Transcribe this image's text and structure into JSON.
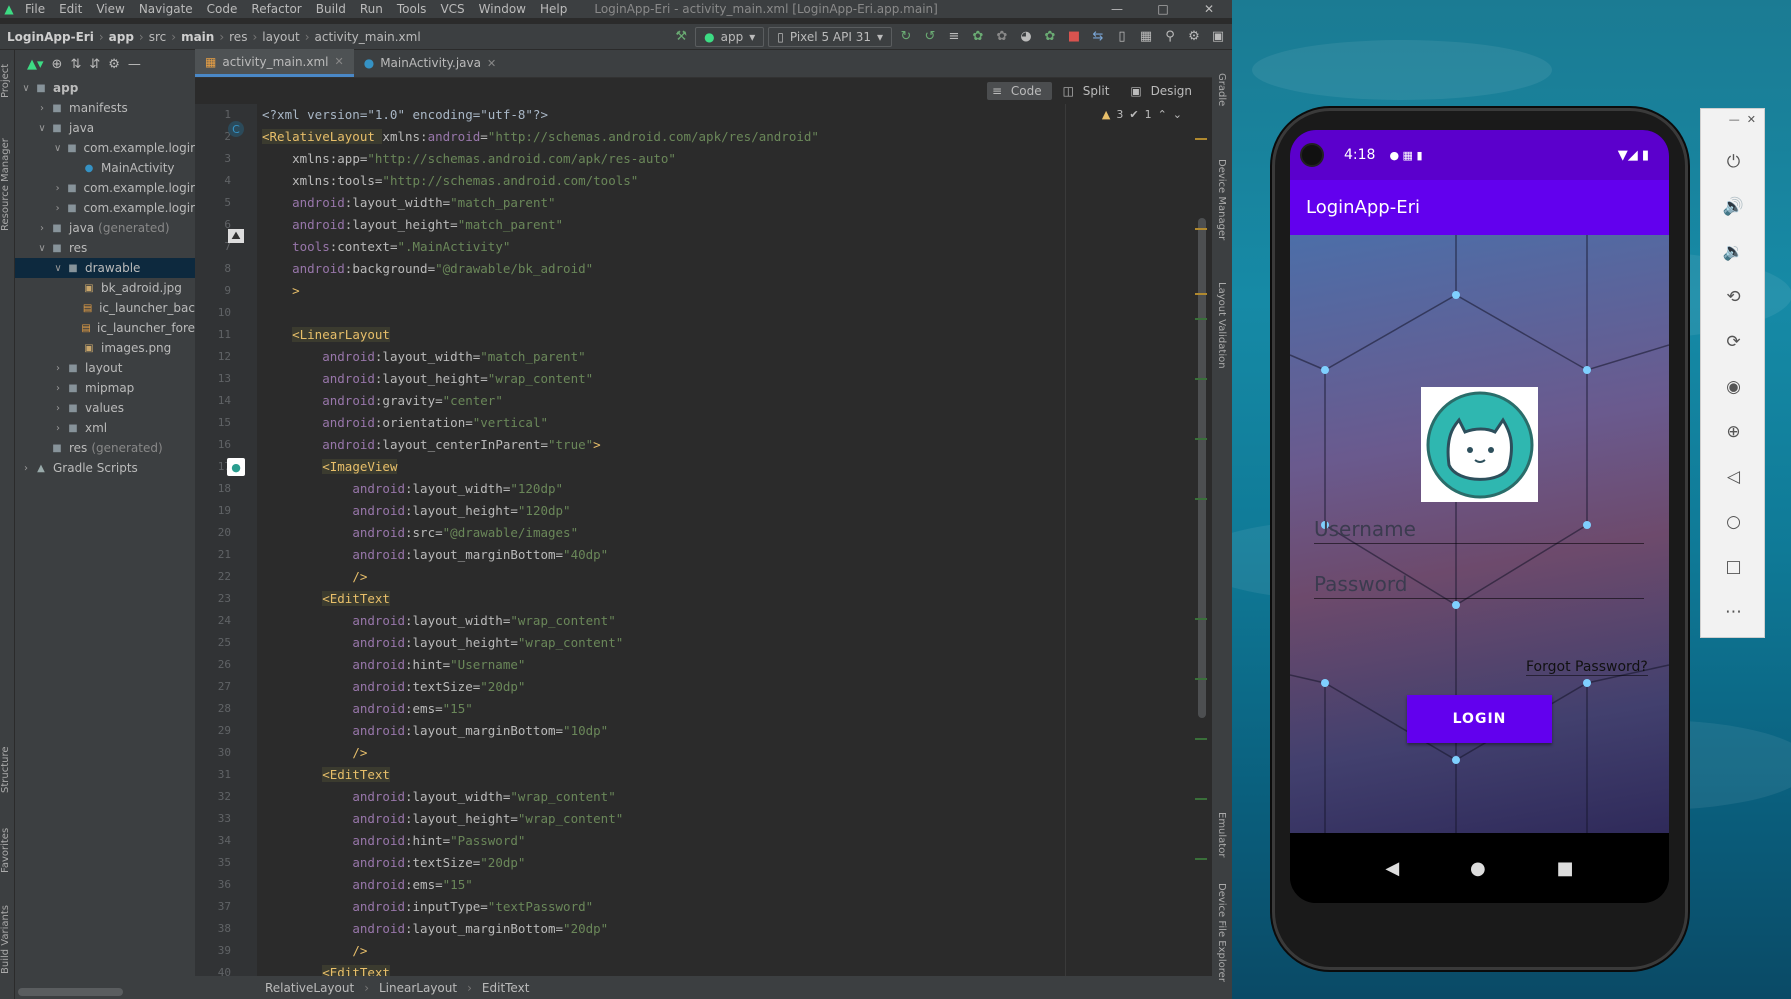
{
  "ide": {
    "menu": [
      "File",
      "Edit",
      "View",
      "Navigate",
      "Code",
      "Refactor",
      "Build",
      "Run",
      "Tools",
      "VCS",
      "Window",
      "Help"
    ],
    "window_title": "LoginApp-Eri - activity_main.xml [LoginApp-Eri.app.main]",
    "breadcrumb": [
      "LoginApp-Eri",
      "app",
      "src",
      "main",
      "res",
      "layout",
      "activity_main.xml"
    ],
    "run_config": "app",
    "device": "Pixel 5 API 31",
    "tabs": [
      "activity_main.xml",
      "MainActivity.java"
    ],
    "view_modes": [
      "Code",
      "Split",
      "Design"
    ],
    "warnings": {
      "warn_count": "3",
      "weak_count": "1"
    },
    "left_tool_windows": [
      "Project",
      "Resource Manager",
      "Structure",
      "Favorites",
      "Build Variants"
    ],
    "right_tool_windows": [
      "Gradle",
      "Device Manager",
      "Layout Validation",
      "Emulator",
      "Device File Explorer"
    ],
    "status_path": [
      "RelativeLayout",
      "LinearLayout",
      "EditText"
    ]
  },
  "project_tree": [
    {
      "label": "app",
      "indent": 0,
      "arrow": "v",
      "type": "folder",
      "bold": true
    },
    {
      "label": "manifests",
      "indent": 1,
      "arrow": ">",
      "type": "folder"
    },
    {
      "label": "java",
      "indent": 1,
      "arrow": "v",
      "type": "folder"
    },
    {
      "label": "com.example.logir",
      "indent": 2,
      "arrow": "v",
      "type": "pkg"
    },
    {
      "label": "MainActivity",
      "indent": 3,
      "arrow": "",
      "type": "class"
    },
    {
      "label": "com.example.logir",
      "indent": 2,
      "arrow": ">",
      "type": "pkg"
    },
    {
      "label": "com.example.logir",
      "indent": 2,
      "arrow": ">",
      "type": "pkg"
    },
    {
      "label": "java",
      "suffix": "(generated)",
      "indent": 1,
      "arrow": ">",
      "type": "folder"
    },
    {
      "label": "res",
      "indent": 1,
      "arrow": "v",
      "type": "folder"
    },
    {
      "label": "drawable",
      "indent": 2,
      "arrow": "v",
      "type": "folder",
      "selected": true
    },
    {
      "label": "bk_adroid.jpg",
      "indent": 3,
      "arrow": "",
      "type": "img"
    },
    {
      "label": "ic_launcher_bac",
      "indent": 3,
      "arrow": "",
      "type": "xml"
    },
    {
      "label": "ic_launcher_fore",
      "indent": 3,
      "arrow": "",
      "type": "xml"
    },
    {
      "label": "images.png",
      "indent": 3,
      "arrow": "",
      "type": "img"
    },
    {
      "label": "layout",
      "indent": 2,
      "arrow": ">",
      "type": "folder"
    },
    {
      "label": "mipmap",
      "indent": 2,
      "arrow": ">",
      "type": "folder"
    },
    {
      "label": "values",
      "indent": 2,
      "arrow": ">",
      "type": "folder"
    },
    {
      "label": "xml",
      "indent": 2,
      "arrow": ">",
      "type": "folder"
    },
    {
      "label": "res",
      "suffix": "(generated)",
      "indent": 1,
      "arrow": "",
      "type": "folder"
    },
    {
      "label": "Gradle Scripts",
      "indent": 0,
      "arrow": ">",
      "type": "gradle"
    }
  ],
  "code_lines": [
    [
      [
        "p",
        "<?xml version=\"1.0\" encoding=\"utf-8\"?>"
      ]
    ],
    [
      [
        "t",
        "<RelativeLayout "
      ],
      [
        "attr",
        "xmlns:"
      ],
      [
        "ns",
        "android"
      ],
      [
        "attr",
        "="
      ],
      [
        "str",
        "\"http://schemas.android.com/apk/res/android\""
      ]
    ],
    [
      [
        "p",
        "    "
      ],
      [
        "attr",
        "xmlns:app="
      ],
      [
        "str",
        "\"http://schemas.android.com/apk/res-auto\""
      ]
    ],
    [
      [
        "p",
        "    "
      ],
      [
        "attr",
        "xmlns:tools="
      ],
      [
        "str",
        "\"http://schemas.android.com/tools\""
      ]
    ],
    [
      [
        "p",
        "    "
      ],
      [
        "ns",
        "android"
      ],
      [
        "attr",
        ":layout_width="
      ],
      [
        "str",
        "\"match_parent\""
      ]
    ],
    [
      [
        "p",
        "    "
      ],
      [
        "ns",
        "android"
      ],
      [
        "attr",
        ":layout_height="
      ],
      [
        "str",
        "\"match_parent\""
      ]
    ],
    [
      [
        "p",
        "    "
      ],
      [
        "ns",
        "tools"
      ],
      [
        "attr",
        ":context="
      ],
      [
        "str",
        "\".MainActivity\""
      ]
    ],
    [
      [
        "p",
        "    "
      ],
      [
        "ns",
        "android"
      ],
      [
        "attr",
        ":background="
      ],
      [
        "str",
        "\"@drawable/bk_adroid\""
      ]
    ],
    [
      [
        "p",
        "    "
      ],
      [
        "t",
        ">"
      ]
    ],
    [
      [
        "p",
        ""
      ]
    ],
    [
      [
        "p",
        "    "
      ],
      [
        "t",
        "<LinearLayout"
      ]
    ],
    [
      [
        "p",
        "        "
      ],
      [
        "ns",
        "android"
      ],
      [
        "attr",
        ":layout_width="
      ],
      [
        "str",
        "\"match_parent\""
      ]
    ],
    [
      [
        "p",
        "        "
      ],
      [
        "ns",
        "android"
      ],
      [
        "attr",
        ":layout_height="
      ],
      [
        "str",
        "\"wrap_content\""
      ]
    ],
    [
      [
        "p",
        "        "
      ],
      [
        "ns",
        "android"
      ],
      [
        "attr",
        ":gravity="
      ],
      [
        "str",
        "\"center\""
      ]
    ],
    [
      [
        "p",
        "        "
      ],
      [
        "ns",
        "android"
      ],
      [
        "attr",
        ":orientation="
      ],
      [
        "str",
        "\"vertical\""
      ]
    ],
    [
      [
        "p",
        "        "
      ],
      [
        "ns",
        "android"
      ],
      [
        "attr",
        ":layout_centerInParent="
      ],
      [
        "str",
        "\"true\""
      ],
      [
        "t",
        ">"
      ]
    ],
    [
      [
        "p",
        "        "
      ],
      [
        "t",
        "<ImageView"
      ]
    ],
    [
      [
        "p",
        "            "
      ],
      [
        "ns",
        "android"
      ],
      [
        "attr",
        ":layout_width="
      ],
      [
        "str",
        "\"120dp\""
      ]
    ],
    [
      [
        "p",
        "            "
      ],
      [
        "ns",
        "android"
      ],
      [
        "attr",
        ":layout_height="
      ],
      [
        "str",
        "\"120dp\""
      ]
    ],
    [
      [
        "p",
        "            "
      ],
      [
        "ns",
        "android"
      ],
      [
        "attr",
        ":src="
      ],
      [
        "str",
        "\"@drawable/images\""
      ]
    ],
    [
      [
        "p",
        "            "
      ],
      [
        "ns",
        "android"
      ],
      [
        "attr",
        ":layout_marginBottom="
      ],
      [
        "str",
        "\"40dp\""
      ]
    ],
    [
      [
        "p",
        "            "
      ],
      [
        "t",
        "/>"
      ]
    ],
    [
      [
        "p",
        "        "
      ],
      [
        "t",
        "<EditText"
      ]
    ],
    [
      [
        "p",
        "            "
      ],
      [
        "ns",
        "android"
      ],
      [
        "attr",
        ":layout_width="
      ],
      [
        "str",
        "\"wrap_content\""
      ]
    ],
    [
      [
        "p",
        "            "
      ],
      [
        "ns",
        "android"
      ],
      [
        "attr",
        ":layout_height="
      ],
      [
        "str",
        "\"wrap_content\""
      ]
    ],
    [
      [
        "p",
        "            "
      ],
      [
        "ns",
        "android"
      ],
      [
        "attr",
        ":hint="
      ],
      [
        "str",
        "\"Username\""
      ]
    ],
    [
      [
        "p",
        "            "
      ],
      [
        "ns",
        "android"
      ],
      [
        "attr",
        ":textSize="
      ],
      [
        "str",
        "\"20dp\""
      ]
    ],
    [
      [
        "p",
        "            "
      ],
      [
        "ns",
        "android"
      ],
      [
        "attr",
        ":ems="
      ],
      [
        "str",
        "\"15\""
      ]
    ],
    [
      [
        "p",
        "            "
      ],
      [
        "ns",
        "android"
      ],
      [
        "attr",
        ":layout_marginBottom="
      ],
      [
        "str",
        "\"10dp\""
      ]
    ],
    [
      [
        "p",
        "            "
      ],
      [
        "t",
        "/>"
      ]
    ],
    [
      [
        "p",
        "        "
      ],
      [
        "t",
        "<EditText"
      ]
    ],
    [
      [
        "p",
        "            "
      ],
      [
        "ns",
        "android"
      ],
      [
        "attr",
        ":layout_width="
      ],
      [
        "str",
        "\"wrap_content\""
      ]
    ],
    [
      [
        "p",
        "            "
      ],
      [
        "ns",
        "android"
      ],
      [
        "attr",
        ":layout_height="
      ],
      [
        "str",
        "\"wrap_content\""
      ]
    ],
    [
      [
        "p",
        "            "
      ],
      [
        "ns",
        "android"
      ],
      [
        "attr",
        ":hint="
      ],
      [
        "str",
        "\"Password\""
      ]
    ],
    [
      [
        "p",
        "            "
      ],
      [
        "ns",
        "android"
      ],
      [
        "attr",
        ":textSize="
      ],
      [
        "str",
        "\"20dp\""
      ]
    ],
    [
      [
        "p",
        "            "
      ],
      [
        "ns",
        "android"
      ],
      [
        "attr",
        ":ems="
      ],
      [
        "str",
        "\"15\""
      ]
    ],
    [
      [
        "p",
        "            "
      ],
      [
        "ns",
        "android"
      ],
      [
        "attr",
        ":inputType="
      ],
      [
        "str",
        "\"textPassword\""
      ]
    ],
    [
      [
        "p",
        "            "
      ],
      [
        "ns",
        "android"
      ],
      [
        "attr",
        ":layout_marginBottom="
      ],
      [
        "str",
        "\"20dp\""
      ]
    ],
    [
      [
        "p",
        "            "
      ],
      [
        "t",
        "/>"
      ]
    ],
    [
      [
        "p",
        "        "
      ],
      [
        "t",
        "<EditText"
      ]
    ]
  ],
  "emulator": {
    "status_time": "4:18",
    "app_title": "LoginApp-Eri",
    "username_hint": "Username",
    "password_hint": "Password",
    "forgot_label": "Forgot Password?",
    "login_label": "LOGIN",
    "nav": [
      "back-icon",
      "home-icon",
      "recents-icon"
    ],
    "side_controls": [
      "power-icon",
      "volume-up-icon",
      "volume-down-icon",
      "rotate-left-icon",
      "rotate-right-icon",
      "camera-icon",
      "zoom-icon",
      "back-icon",
      "home-icon",
      "overview-icon",
      "more-icon"
    ]
  },
  "colors": {
    "accent": "#6200ee",
    "statusbar": "#5b00cc",
    "ide_bg": "#2b2b2b"
  }
}
